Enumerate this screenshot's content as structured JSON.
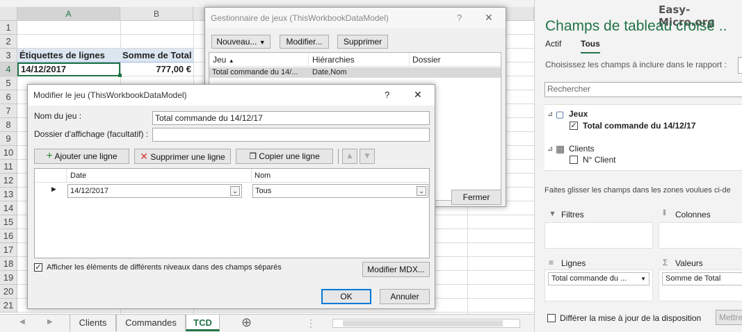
{
  "watermark": "Easy-Micro.org",
  "sheet": {
    "columns": [
      "A",
      "B"
    ],
    "rows": [
      "1",
      "2",
      "3",
      "4",
      "5",
      "6",
      "7",
      "8",
      "9",
      "10",
      "11",
      "12",
      "13",
      "14",
      "15",
      "16",
      "17",
      "18",
      "19",
      "20",
      "21"
    ],
    "a3": "Étiquettes de lignes",
    "b3": "Somme de Total",
    "a4": "14/12/2017",
    "b4": "777,00 €",
    "tabs": [
      "Clients",
      "Commandes",
      "TCD"
    ],
    "active_tab": "TCD",
    "add_tab_symbol": "⊕"
  },
  "set_manager": {
    "title": "Gestionnaire de jeux (ThisWorkbookDataModel)",
    "help": "?",
    "close": "✕",
    "new_btn": "Nouveau...",
    "edit_btn": "Modifier...",
    "delete_btn": "Supprimer",
    "col_jeu": "Jeu",
    "col_hier": "Hiérarchies",
    "col_dossier": "Dossier",
    "row_jeu": "Total commande du 14/...",
    "row_hier": "Date,Nom",
    "close_btn": "Fermer"
  },
  "edit_set": {
    "title": "Modifier le jeu (ThisWorkbookDataModel)",
    "help": "?",
    "close": "✕",
    "name_label": "Nom du jeu :",
    "name_value": "Total commande du 14/12/17",
    "folder_label": "Dossier d'affichage (facultatif) :",
    "folder_value": "",
    "add_row": "Ajouter une ligne",
    "delete_row": "Supprimer une ligne",
    "copy_row": "Copier une ligne",
    "col_date": "Date",
    "col_nom": "Nom",
    "date_value": "14/12/2017",
    "nom_value": "Tous",
    "separate_levels": "Afficher les éléments de différents niveaux dans des champs séparés",
    "edit_mdx": "Modifier MDX...",
    "ok": "OK",
    "cancel": "Annuler"
  },
  "pivot_pane": {
    "title": "Champs de tableau croisé ..",
    "tab_active": "Actif",
    "tab_all": "Tous",
    "choose_label": "Choisissez les champs à inclure dans le rapport :",
    "search_placeholder": "Rechercher",
    "group_sets": "Jeux",
    "set_item": "Total commande du 14/12/17",
    "group_clients": "Clients",
    "client_item": "N° Client",
    "drag_label": "Faites glisser les champs dans les zones voulues ci-de",
    "filters": "Filtres",
    "columns": "Colonnes",
    "rows": "Lignes",
    "values": "Valeurs",
    "rows_field": "Total commande du ...",
    "values_field": "Somme de Total",
    "defer_label": "Différer la mise à jour de la disposition",
    "update_btn": "Mettre"
  },
  "colors": {
    "accent": "#0078d7",
    "pane_title": "#217346",
    "header_fill": "#dce6f1",
    "selection": "#217346"
  }
}
